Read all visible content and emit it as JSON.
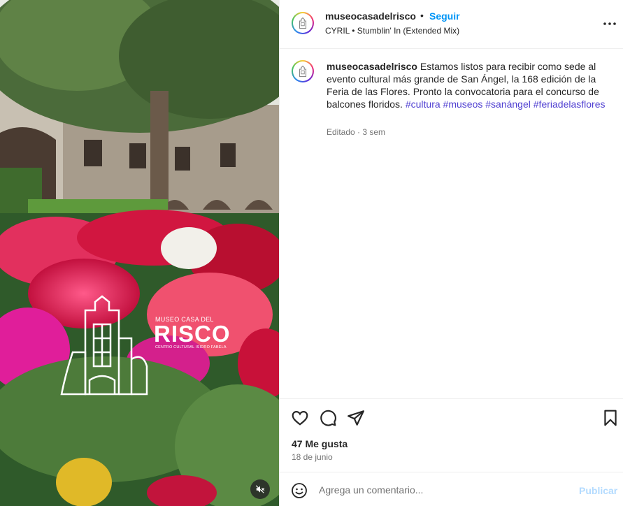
{
  "post": {
    "username": "museocasadelrisco",
    "separator": "•",
    "follow_label": "Seguir",
    "audio": "CYRIL • Stumblin' In (Extended Mix)",
    "caption_text": "Estamos listos para recibir como sede al evento cultural más grande de San Ángel, la 168 edición de la Feria de las Flores. Pronto la convocatoria para el concurso de balcones floridos.",
    "hashtags": [
      "#cultura",
      "#museos",
      "#sanángel",
      "#feriadelasflores"
    ],
    "caption_meta": "Editado · 3 sem",
    "likes": "47 Me gusta",
    "date": "18 de junio"
  },
  "media": {
    "logo_title": "MUSEO CASA DEL",
    "logo_name": "RISCO",
    "logo_subtitle": "CENTRO CULTURAL ISIDRO FABELA"
  },
  "comment": {
    "placeholder": "Agrega un comentario...",
    "publish_label": "Publicar"
  },
  "colors": {
    "follow": "#0095f6",
    "hashtag": "#4f3fd1",
    "publish_disabled": "#b3dbff",
    "muted_text": "#737373"
  },
  "icons": [
    "more-options-icon",
    "heart-icon",
    "comment-icon",
    "share-icon",
    "bookmark-icon",
    "emoji-icon",
    "muted-speaker-icon"
  ]
}
